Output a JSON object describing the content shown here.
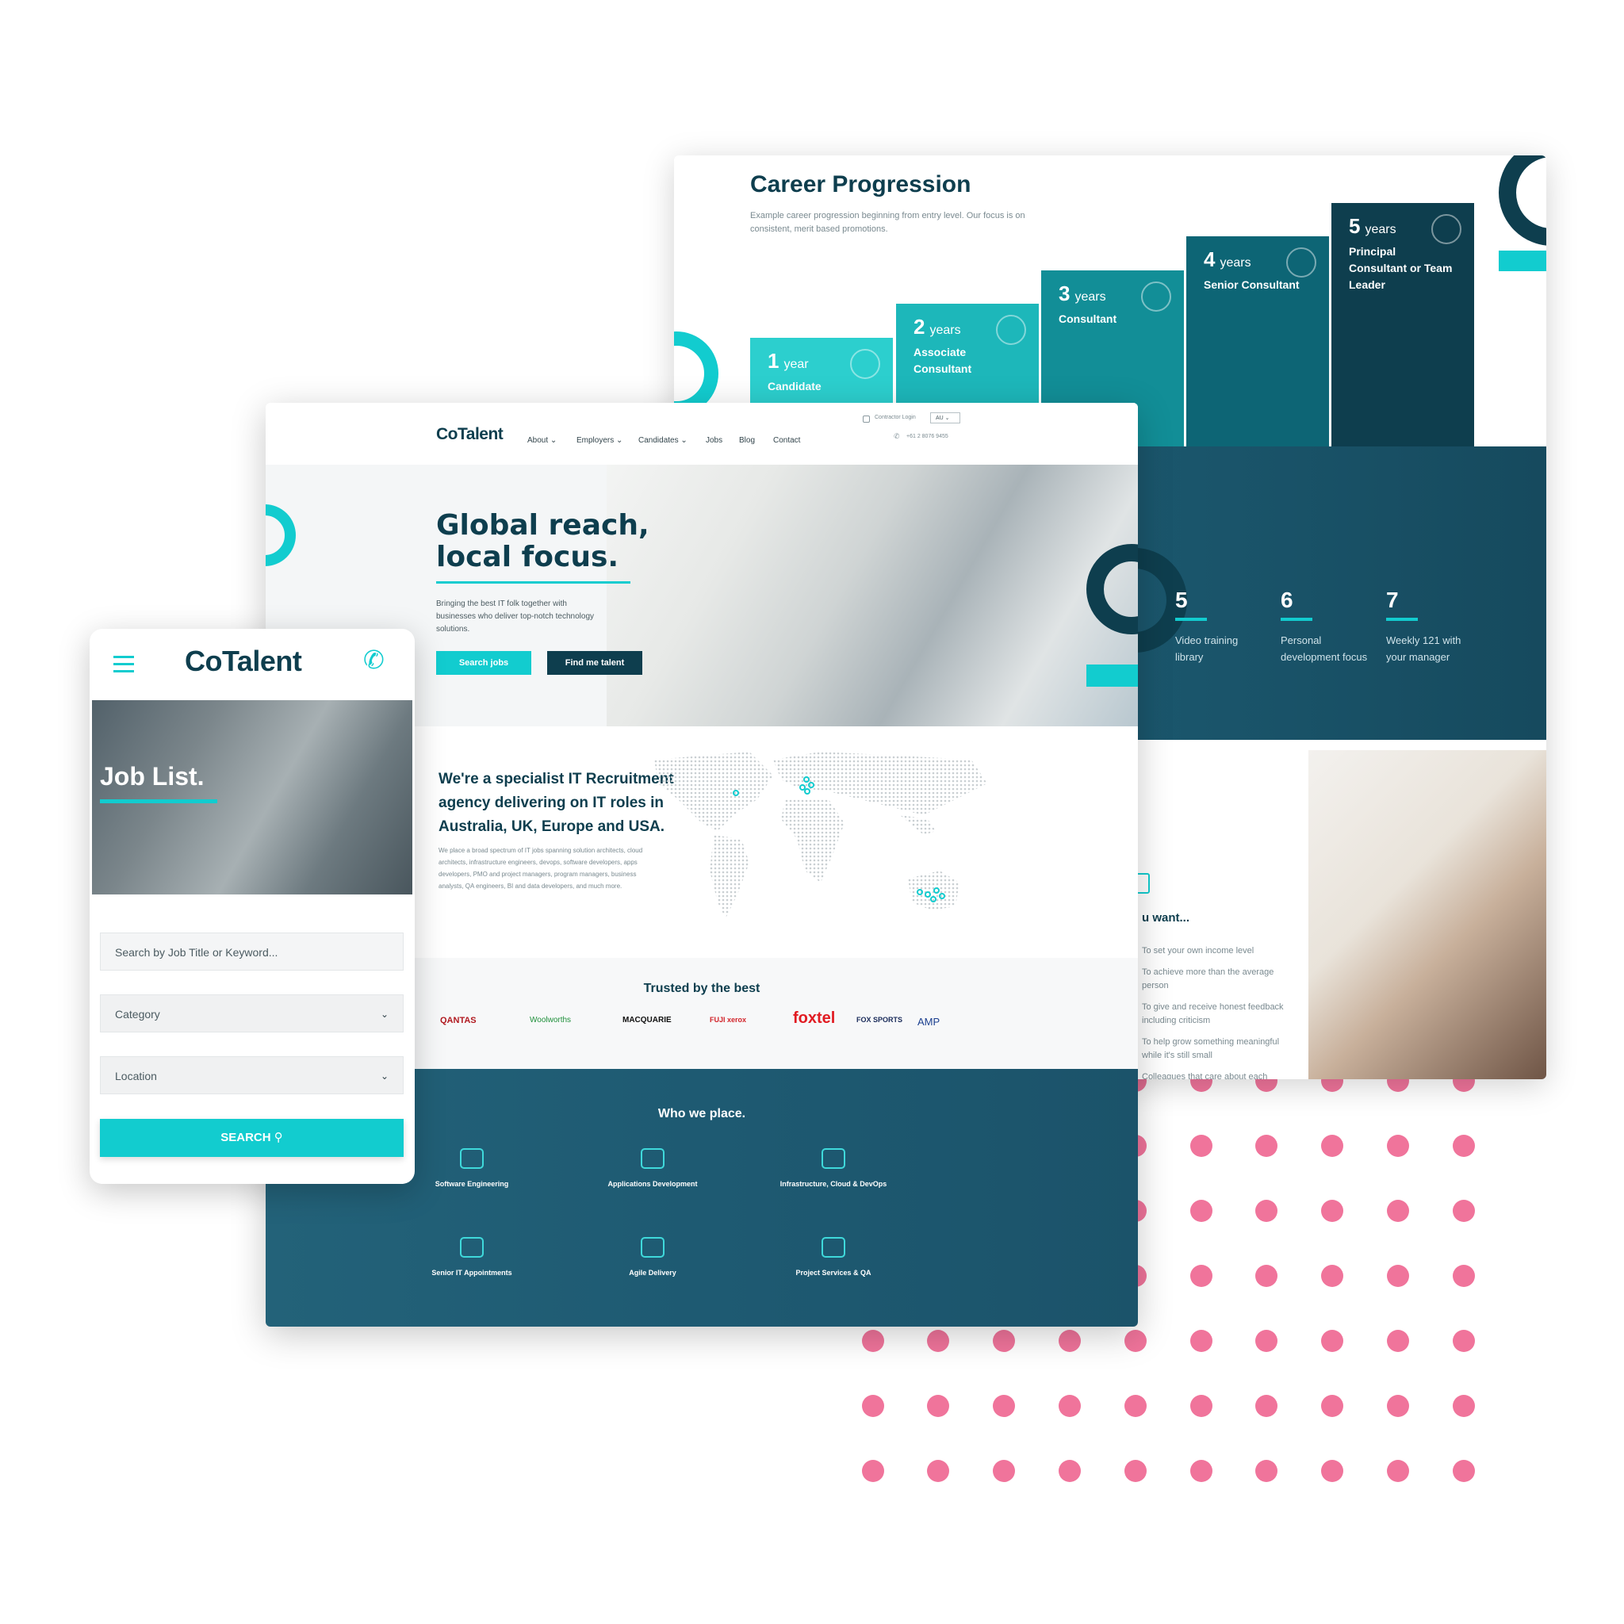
{
  "colors": {
    "teal": "#12cccf",
    "navy": "#0e3e4e",
    "pink_dots": "#f0749b"
  },
  "career": {
    "title": "Career Progression",
    "subtitle": "Example career progression beginning from entry level. Our focus is on consistent, merit based promotions.",
    "steps": [
      {
        "years": "1",
        "unit": "year",
        "role": "Candidate",
        "icon": "smile-icon"
      },
      {
        "years": "2",
        "unit": "years",
        "role": "Associate Consultant",
        "icon": "star-icon"
      },
      {
        "years": "3",
        "unit": "years",
        "role": "Consultant",
        "icon": "users-star-icon"
      },
      {
        "years": "4",
        "unit": "years",
        "role": "Senior Consultant",
        "icon": "team-icon"
      },
      {
        "years": "5",
        "unit": "years",
        "role": "Principal Consultant or Team Leader",
        "icon": "award-icon"
      }
    ],
    "stats": [
      {
        "num": "5",
        "text": "Video training library"
      },
      {
        "num": "6",
        "text": "Personal development focus"
      },
      {
        "num": "7",
        "text": "Weekly 121 with your manager"
      }
    ],
    "want_title": "u want...",
    "want_list": [
      "To set your own income level",
      "To achieve more than the average person",
      "To give and receive honest feedback including criticism",
      "To help grow something meaningful while it's still small",
      "Colleagues that care about each"
    ]
  },
  "desktop": {
    "logo": "CoTalent",
    "nav": [
      "About",
      "Employers",
      "Candidates",
      "Jobs",
      "Blog",
      "Contact"
    ],
    "contractor_login": "Contractor Login",
    "region": "AU",
    "phone": "+61 2 8076 9455",
    "hero_title_1": "Global reach,",
    "hero_title_2": "local focus.",
    "hero_text": "Bringing the best IT folk together with businesses who deliver top-notch technology solutions.",
    "btn_search": "Search jobs",
    "btn_talent": "Find me talent",
    "spec_title": "We're a specialist IT Recruitment agency delivering on IT roles in Australia, UK, Europe and USA.",
    "spec_text": "We place a broad spectrum of IT jobs spanning solution architects, cloud architects, infrastructure engineers, devops, software developers, apps developers, PMO and project managers, program managers, business analysts, QA engineers, BI and data developers, and much more.",
    "trusted_title": "Trusted by the best",
    "brands": [
      "QANTAS",
      "Woolworths",
      "MACQUARIE",
      "FUJI xerox",
      "foxtel",
      "FOX SPORTS",
      "AMP"
    ],
    "who_title": "Who we place.",
    "categories": [
      {
        "label": "Software Engineering",
        "icon": "monitor-code-icon"
      },
      {
        "label": "Applications Development",
        "icon": "code-window-icon"
      },
      {
        "label": "Infrastructure, Cloud & DevOps",
        "icon": "cloud-server-icon"
      },
      {
        "label": "Senior IT Appointments",
        "icon": "person-check-icon"
      },
      {
        "label": "Agile Delivery",
        "icon": "gauge-icon"
      },
      {
        "label": "Project Services & QA",
        "icon": "clipboard-check-icon"
      }
    ]
  },
  "mobile": {
    "logo": "CoTalent",
    "menu_icon": "hamburger-icon",
    "phone_icon": "phone-icon",
    "title": "Job List.",
    "search_placeholder": "Search by Job Title or Keyword...",
    "category": "Category",
    "location": "Location",
    "search_btn": "SEARCH"
  }
}
